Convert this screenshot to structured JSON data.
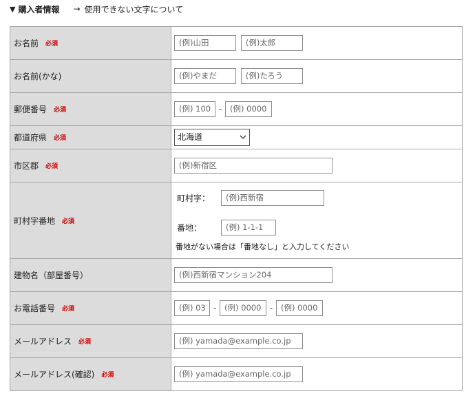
{
  "header": {
    "triangle": "▼",
    "title": "購入者情報",
    "arrow": "→",
    "link": "使用できない文字について"
  },
  "required_label": "必須",
  "rows": {
    "name": {
      "label": "お名前",
      "ph_last": "(例)山田",
      "ph_first": "(例)太郎"
    },
    "kana": {
      "label": "お名前(かな)",
      "ph_last": "(例)やまだ",
      "ph_first": "(例)たろう"
    },
    "zip": {
      "label": "郵便番号",
      "ph_1": "(例) 100",
      "separator": "-",
      "ph_2": "(例) 0000"
    },
    "prefecture": {
      "label": "都道府県",
      "selected": "北海道"
    },
    "city": {
      "label": "市区郡",
      "placeholder": "(例)新宿区"
    },
    "address": {
      "label": "町村字番地",
      "town_label": "町村字：",
      "town_placeholder": "(例)西新宿",
      "number_label": "番地：",
      "number_placeholder": "(例) 1-1-1",
      "note": "番地がない場合は「番地なし」と入力してください"
    },
    "building": {
      "label": "建物名（部屋番号）",
      "placeholder": "(例)西新宿マンション204"
    },
    "phone": {
      "label": "お電話番号",
      "ph_1": "(例) 03",
      "sep": "-",
      "ph_2": "(例) 0000",
      "ph_3": "(例) 0000"
    },
    "email": {
      "label": "メールアドレス",
      "placeholder": "(例) yamada@example.co.jp"
    },
    "email_confirm": {
      "label": "メールアドレス(確認)",
      "placeholder": "(例) yamada@example.co.jp"
    }
  }
}
